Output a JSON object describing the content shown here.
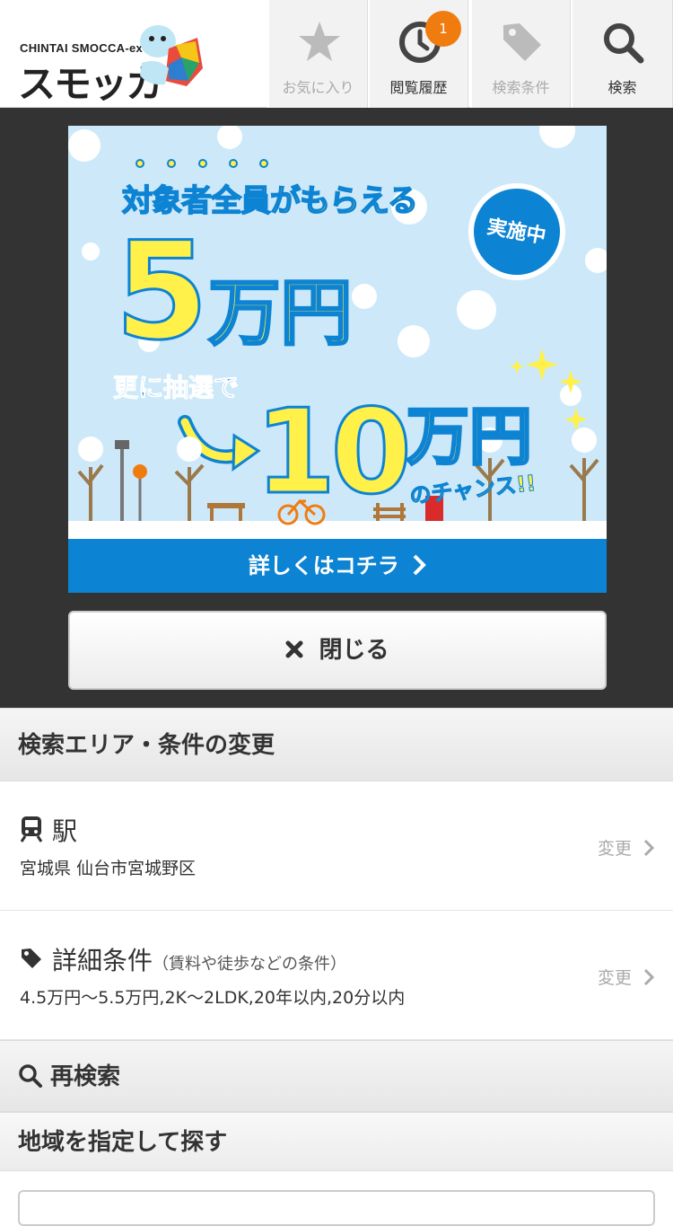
{
  "header": {
    "logo_sub": "CHINTAI SMOCCA-ex",
    "logo_main": "スモッカ",
    "nav": [
      {
        "label": "お気に入り",
        "icon": "star-icon",
        "enabled": false
      },
      {
        "label": "閲覧履歴",
        "icon": "clock-icon",
        "enabled": true,
        "badge": "1"
      },
      {
        "label": "検索条件",
        "icon": "tag-icon",
        "enabled": false
      },
      {
        "label": "検索",
        "icon": "search-icon",
        "enabled": true
      }
    ]
  },
  "banner": {
    "line1": "対象者全員がもらえる",
    "amount1_num": "5",
    "amount1_unit": "万円",
    "badge": "実施中",
    "line2": "更に抽選で",
    "amount2_num": "10",
    "amount2_unit": "万円",
    "line3": "のチャンス!!",
    "cta": "詳しくはコチラ",
    "colors": {
      "sky": "#cde9f9",
      "accent_blue": "#0d83d3",
      "yellow": "#fff04a"
    }
  },
  "close_button": {
    "label": "閉じる",
    "icon": "x-icon"
  },
  "search_change": {
    "title": "検索エリア・条件の変更",
    "station": {
      "label": "駅",
      "value": "宮城県 仙台市宮城野区",
      "change": "変更"
    },
    "detail": {
      "label": "詳細条件",
      "note": "（賃料や徒歩などの条件）",
      "value": "4.5万円〜5.5万円,2K〜2LDK,20年以内,20分以内",
      "change": "変更"
    }
  },
  "research": {
    "title": "再検索"
  },
  "area_search": {
    "title": "地域を指定して探す"
  }
}
